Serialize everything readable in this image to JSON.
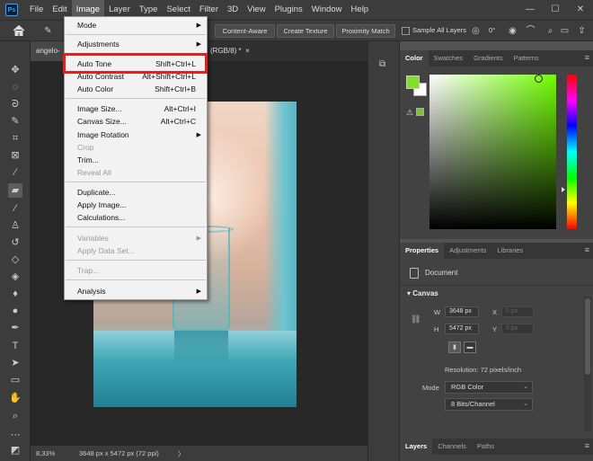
{
  "app": {
    "logo": "Ps",
    "menus": [
      "File",
      "Edit",
      "Image",
      "Layer",
      "Type",
      "Select",
      "Filter",
      "3D",
      "View",
      "Plugins",
      "Window",
      "Help"
    ],
    "active_menu": "Image",
    "window_controls": [
      "—",
      "☐",
      "✕"
    ]
  },
  "options_bar": {
    "content_aware": "Content-Aware",
    "create_texture": "Create Texture",
    "proximity_match": "Proximity Match",
    "sample_all_layers": "Sample All Layers",
    "angle": "0°"
  },
  "document": {
    "tab_title_left": "angelo-",
    "tab_title_right": "(RGB/8) *",
    "tab_close": "×"
  },
  "status": {
    "zoom": "8,33%",
    "dims": "3648 px x 5472 px (72 ppi)",
    "arrow": "〉"
  },
  "image_menu": {
    "items": [
      {
        "label": "Mode",
        "shortcut": "",
        "submenu": true,
        "disabled": false
      },
      {
        "label": "Adjustments",
        "shortcut": "",
        "submenu": true,
        "disabled": false
      },
      {
        "label": "Auto Tone",
        "shortcut": "Shift+Ctrl+L",
        "submenu": false,
        "disabled": false
      },
      {
        "label": "Auto Contrast",
        "shortcut": "Alt+Shift+Ctrl+L",
        "submenu": false,
        "disabled": false
      },
      {
        "label": "Auto Color",
        "shortcut": "Shift+Ctrl+B",
        "submenu": false,
        "disabled": false
      },
      {
        "label": "Image Size...",
        "shortcut": "Alt+Ctrl+I",
        "submenu": false,
        "disabled": false
      },
      {
        "label": "Canvas Size...",
        "shortcut": "Alt+Ctrl+C",
        "submenu": false,
        "disabled": false
      },
      {
        "label": "Image Rotation",
        "shortcut": "",
        "submenu": true,
        "disabled": false
      },
      {
        "label": "Crop",
        "shortcut": "",
        "submenu": false,
        "disabled": true
      },
      {
        "label": "Trim...",
        "shortcut": "",
        "submenu": false,
        "disabled": false
      },
      {
        "label": "Reveal All",
        "shortcut": "",
        "submenu": false,
        "disabled": true
      },
      {
        "label": "Duplicate...",
        "shortcut": "",
        "submenu": false,
        "disabled": false
      },
      {
        "label": "Apply Image...",
        "shortcut": "",
        "submenu": false,
        "disabled": false
      },
      {
        "label": "Calculations...",
        "shortcut": "",
        "submenu": false,
        "disabled": false
      },
      {
        "label": "Variables",
        "shortcut": "",
        "submenu": true,
        "disabled": true
      },
      {
        "label": "Apply Data Set...",
        "shortcut": "",
        "submenu": false,
        "disabled": true
      },
      {
        "label": "Trap...",
        "shortcut": "",
        "submenu": false,
        "disabled": true
      },
      {
        "label": "Analysis",
        "shortcut": "",
        "submenu": true,
        "disabled": false
      }
    ],
    "highlighted": "Auto Tone"
  },
  "color_panel": {
    "tabs": [
      "Color",
      "Swatches",
      "Gradients",
      "Patterns"
    ],
    "active_tab": "Color",
    "foreground": "#7fe02c",
    "background": "#ffffff"
  },
  "properties_panel": {
    "tabs": [
      "Properties",
      "Adjustments",
      "Libraries"
    ],
    "active_tab": "Properties",
    "document_label": "Document",
    "section": "Canvas",
    "w_label": "W",
    "w_value": "3648 px",
    "h_label": "H",
    "h_value": "5472 px",
    "x_label": "X",
    "x_value": "0 px",
    "y_label": "Y",
    "y_value": "0 px",
    "resolution": "Resolution: 72 pixels/inch",
    "mode_label": "Mode",
    "mode_value": "RGB Color",
    "depth_value": "8 Bits/Channel"
  },
  "layers_panel": {
    "tabs": [
      "Layers",
      "Channels",
      "Paths"
    ],
    "active_tab": "Layers"
  }
}
